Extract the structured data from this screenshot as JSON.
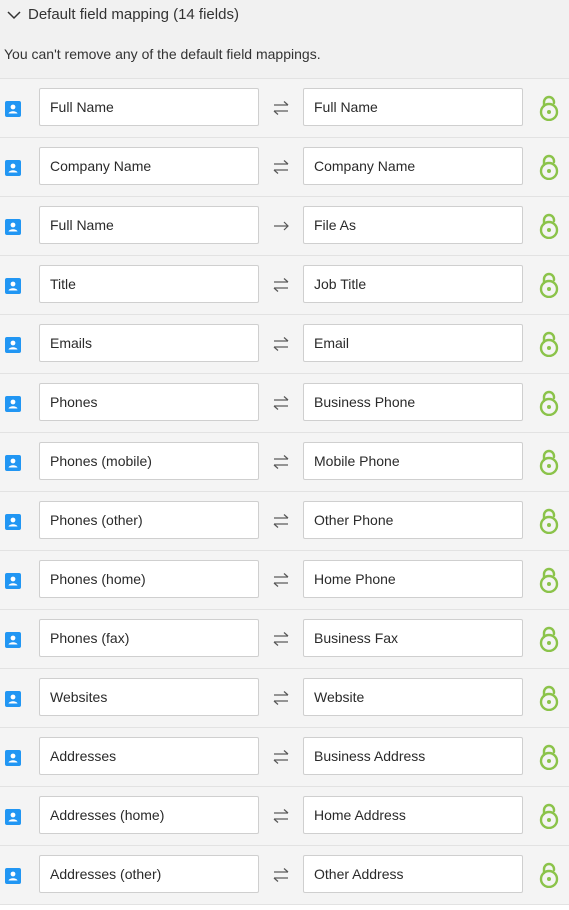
{
  "section": {
    "title": "Default field mapping (14 fields)",
    "description": "You can't remove any of the default field mappings."
  },
  "colors": {
    "accent_green": "#8bc34a",
    "contact_blue": "#2196f3"
  },
  "mappings": [
    {
      "source": "Full Name",
      "target": "Full Name",
      "direction": "two-way"
    },
    {
      "source": "Company Name",
      "target": "Company Name",
      "direction": "two-way"
    },
    {
      "source": "Full Name",
      "target": "File As",
      "direction": "one-way"
    },
    {
      "source": "Title",
      "target": "Job Title",
      "direction": "two-way"
    },
    {
      "source": "Emails",
      "target": "Email",
      "direction": "two-way"
    },
    {
      "source": "Phones",
      "target": "Business Phone",
      "direction": "two-way"
    },
    {
      "source": "Phones (mobile)",
      "target": "Mobile Phone",
      "direction": "two-way"
    },
    {
      "source": "Phones (other)",
      "target": "Other Phone",
      "direction": "two-way"
    },
    {
      "source": "Phones (home)",
      "target": "Home Phone",
      "direction": "two-way"
    },
    {
      "source": "Phones (fax)",
      "target": "Business Fax",
      "direction": "two-way"
    },
    {
      "source": "Websites",
      "target": "Website",
      "direction": "two-way"
    },
    {
      "source": "Addresses",
      "target": "Business Address",
      "direction": "two-way"
    },
    {
      "source": "Addresses (home)",
      "target": "Home Address",
      "direction": "two-way"
    },
    {
      "source": "Addresses (other)",
      "target": "Other Address",
      "direction": "two-way"
    }
  ],
  "icons": {
    "header": "chevron-down-icon",
    "row_source": "contact-card-icon",
    "row_lock": "unlocked-padlock-icon"
  }
}
